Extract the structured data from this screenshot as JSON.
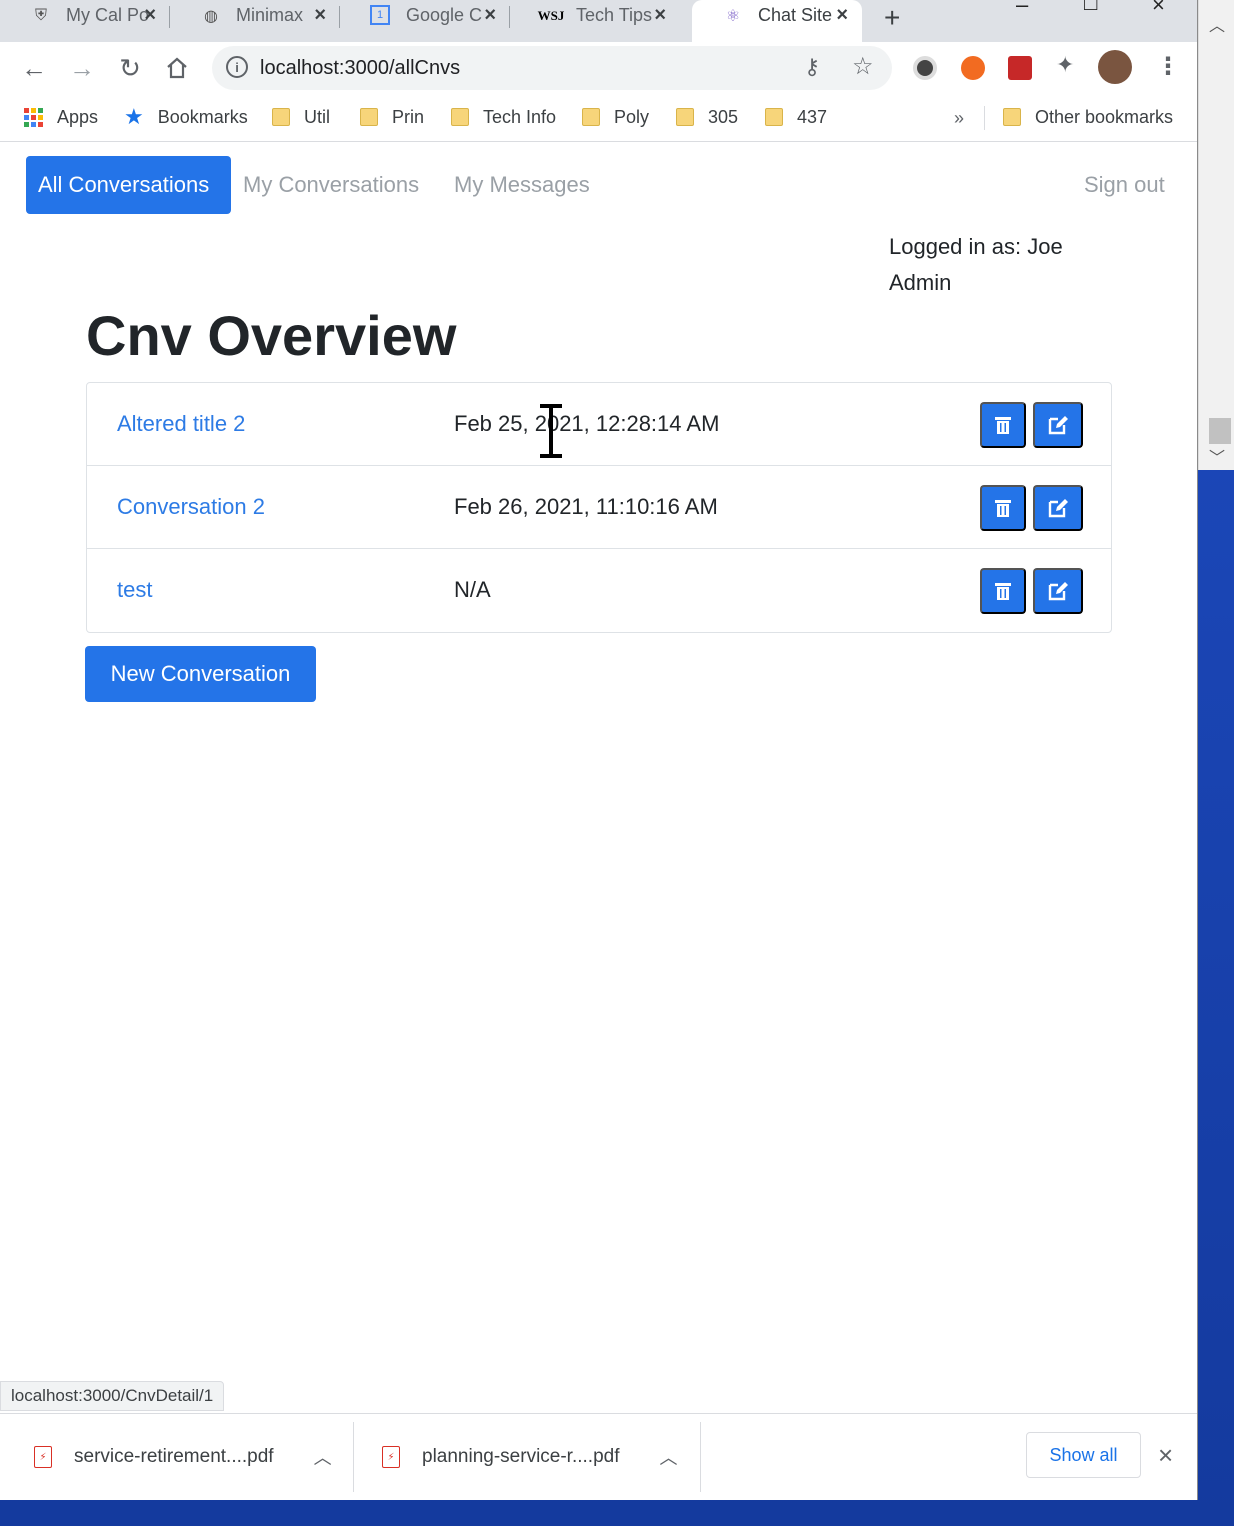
{
  "browser": {
    "tabs": [
      {
        "title": "My Cal Po",
        "icon": "shield-icon",
        "active": false
      },
      {
        "title": "Minimax",
        "icon": "globe-icon",
        "active": false
      },
      {
        "title": "Google C",
        "icon": "calendar-icon",
        "active": false
      },
      {
        "title": "Tech Tips",
        "icon": "wsj-icon",
        "active": false
      },
      {
        "title": "Chat Site",
        "icon": "react-icon",
        "active": true
      }
    ],
    "url": "localhost:3000/allCnvs",
    "bookmarks": {
      "apps": "Apps",
      "bookmarks": "Bookmarks",
      "folders": [
        "Util",
        "Prin",
        "Tech Info",
        "Poly",
        "305",
        "437"
      ],
      "more": "»",
      "other": "Other bookmarks"
    }
  },
  "nav": {
    "all_conversations": "All Conversations",
    "my_conversations": "My Conversations",
    "my_messages": "My Messages",
    "sign_out": "Sign out"
  },
  "user": {
    "logged_in_line1": "Logged in as: Joe",
    "logged_in_line2": "Admin"
  },
  "main": {
    "title": "Cnv Overview",
    "conversations": [
      {
        "title": "Altered title 2",
        "date": "Feb 25, 2021, 12:28:14 AM"
      },
      {
        "title": "Conversation 2",
        "date": "Feb 26, 2021, 11:10:16 AM"
      },
      {
        "title": "test",
        "date": "N/A"
      }
    ],
    "new_button": "New Conversation"
  },
  "status_bar": {
    "hover_url": "localhost:3000/CnvDetail/1"
  },
  "downloads": {
    "items": [
      "service-retirement....pdf",
      "planning-service-r....pdf"
    ],
    "show_all": "Show all"
  },
  "colors": {
    "primary": "#2474e8",
    "link": "#2d7be5",
    "nav_muted": "#9aa0a6"
  }
}
